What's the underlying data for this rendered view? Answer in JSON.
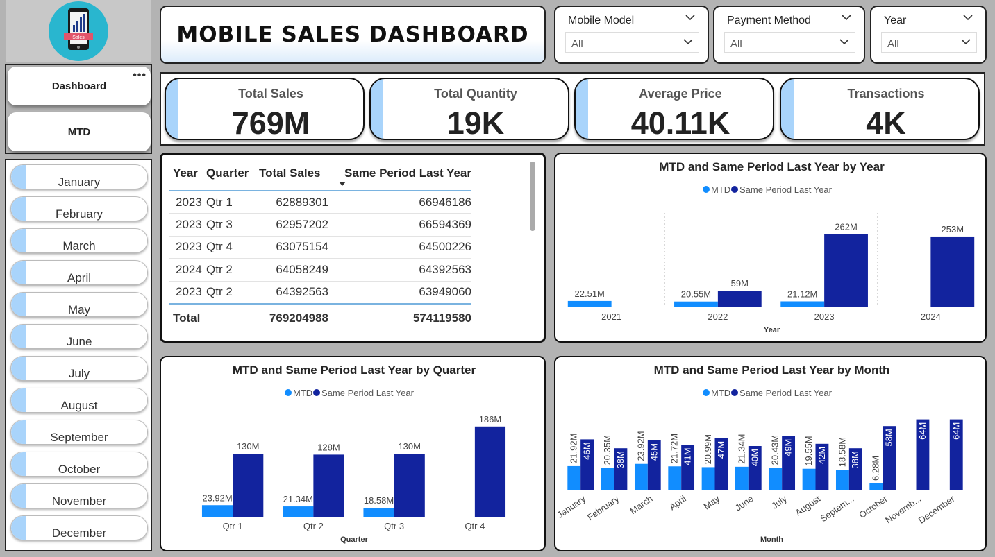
{
  "title": "MOBILE SALES DASHBOARD",
  "logo": {
    "caption": "Sales"
  },
  "nav": {
    "items": [
      {
        "label": "Dashboard"
      },
      {
        "label": "MTD"
      }
    ],
    "more": "•••"
  },
  "months": [
    "January",
    "February",
    "March",
    "April",
    "May",
    "June",
    "July",
    "August",
    "September",
    "October",
    "November",
    "December"
  ],
  "slicers": [
    {
      "title": "Mobile Model",
      "value": "All"
    },
    {
      "title": "Payment Method",
      "value": "All"
    },
    {
      "title": "Year",
      "value": "All"
    }
  ],
  "kpis": [
    {
      "label": "Total Sales",
      "value": "769M"
    },
    {
      "label": "Total Quantity",
      "value": "19K"
    },
    {
      "label": "Average Price",
      "value": "40.11K"
    },
    {
      "label": "Transactions",
      "value": "4K"
    }
  ],
  "table": {
    "columns": [
      "Year",
      "Quarter",
      "Total Sales",
      "Same Period Last Year"
    ],
    "rows": [
      [
        "2023",
        "Qtr 1",
        "62889301",
        "66946186"
      ],
      [
        "2023",
        "Qtr 3",
        "62957202",
        "66594369"
      ],
      [
        "2023",
        "Qtr 4",
        "63075154",
        "64500226"
      ],
      [
        "2024",
        "Qtr 2",
        "64058249",
        "64392563"
      ],
      [
        "2023",
        "Qtr 2",
        "64392563",
        "63949060"
      ]
    ],
    "total": {
      "label": "Total",
      "total_sales": "769204988",
      "same_period": "574119580"
    }
  },
  "colors": {
    "mtd": "#118dff",
    "same_period": "#12239e",
    "accent": "#a9d4fb"
  },
  "chart_data": [
    {
      "type": "bar",
      "title": "MTD and Same Period Last Year by Year",
      "xlabel": "Year",
      "categories": [
        "2021",
        "2022",
        "2023",
        "2024"
      ],
      "series": [
        {
          "name": "MTD",
          "values": [
            22.51,
            20.55,
            21.12,
            null
          ],
          "labels": [
            "22.51M",
            "20.55M",
            "21.12M",
            ""
          ]
        },
        {
          "name": "Same Period Last Year",
          "values": [
            null,
            59,
            262,
            253
          ],
          "labels": [
            "",
            "59M",
            "262M",
            "253M"
          ]
        }
      ],
      "ylim": [
        0,
        300
      ]
    },
    {
      "type": "bar",
      "title": "MTD and Same Period Last Year by Quarter",
      "xlabel": "Quarter",
      "categories": [
        "Qtr 1",
        "Qtr 2",
        "Qtr 3",
        "Qtr 4"
      ],
      "series": [
        {
          "name": "MTD",
          "values": [
            23.92,
            21.34,
            18.58,
            null
          ],
          "labels": [
            "23.92M",
            "21.34M",
            "18.58M",
            ""
          ]
        },
        {
          "name": "Same Period Last Year",
          "values": [
            130,
            128,
            130,
            186
          ],
          "labels": [
            "130M",
            "128M",
            "130M",
            "186M"
          ]
        }
      ],
      "ylim": [
        0,
        200
      ]
    },
    {
      "type": "bar",
      "title": "MTD and Same Period Last Year by Month",
      "xlabel": "Month",
      "categories": [
        "January",
        "February",
        "March",
        "April",
        "May",
        "June",
        "July",
        "August",
        "Septem...",
        "October",
        "Novemb...",
        "December"
      ],
      "series": [
        {
          "name": "MTD",
          "values": [
            21.92,
            20.35,
            23.92,
            21.72,
            20.99,
            21.34,
            20.43,
            19.55,
            18.58,
            6.28,
            null,
            null
          ],
          "labels": [
            "21.92M",
            "20.35M",
            "23.92M",
            "21.72M",
            "20.99M",
            "21.34M",
            "20.43M",
            "19.55M",
            "18.58M",
            "6.28M",
            "",
            ""
          ]
        },
        {
          "name": "Same Period Last Year",
          "values": [
            46,
            38,
            45,
            41,
            47,
            40,
            49,
            42,
            38,
            58,
            64,
            64
          ],
          "labels": [
            "46M",
            "38M",
            "45M",
            "41M",
            "47M",
            "40M",
            "49M",
            "42M",
            "38M",
            "58M",
            "64M",
            "64M"
          ]
        }
      ],
      "ylim": [
        0,
        70
      ]
    }
  ]
}
